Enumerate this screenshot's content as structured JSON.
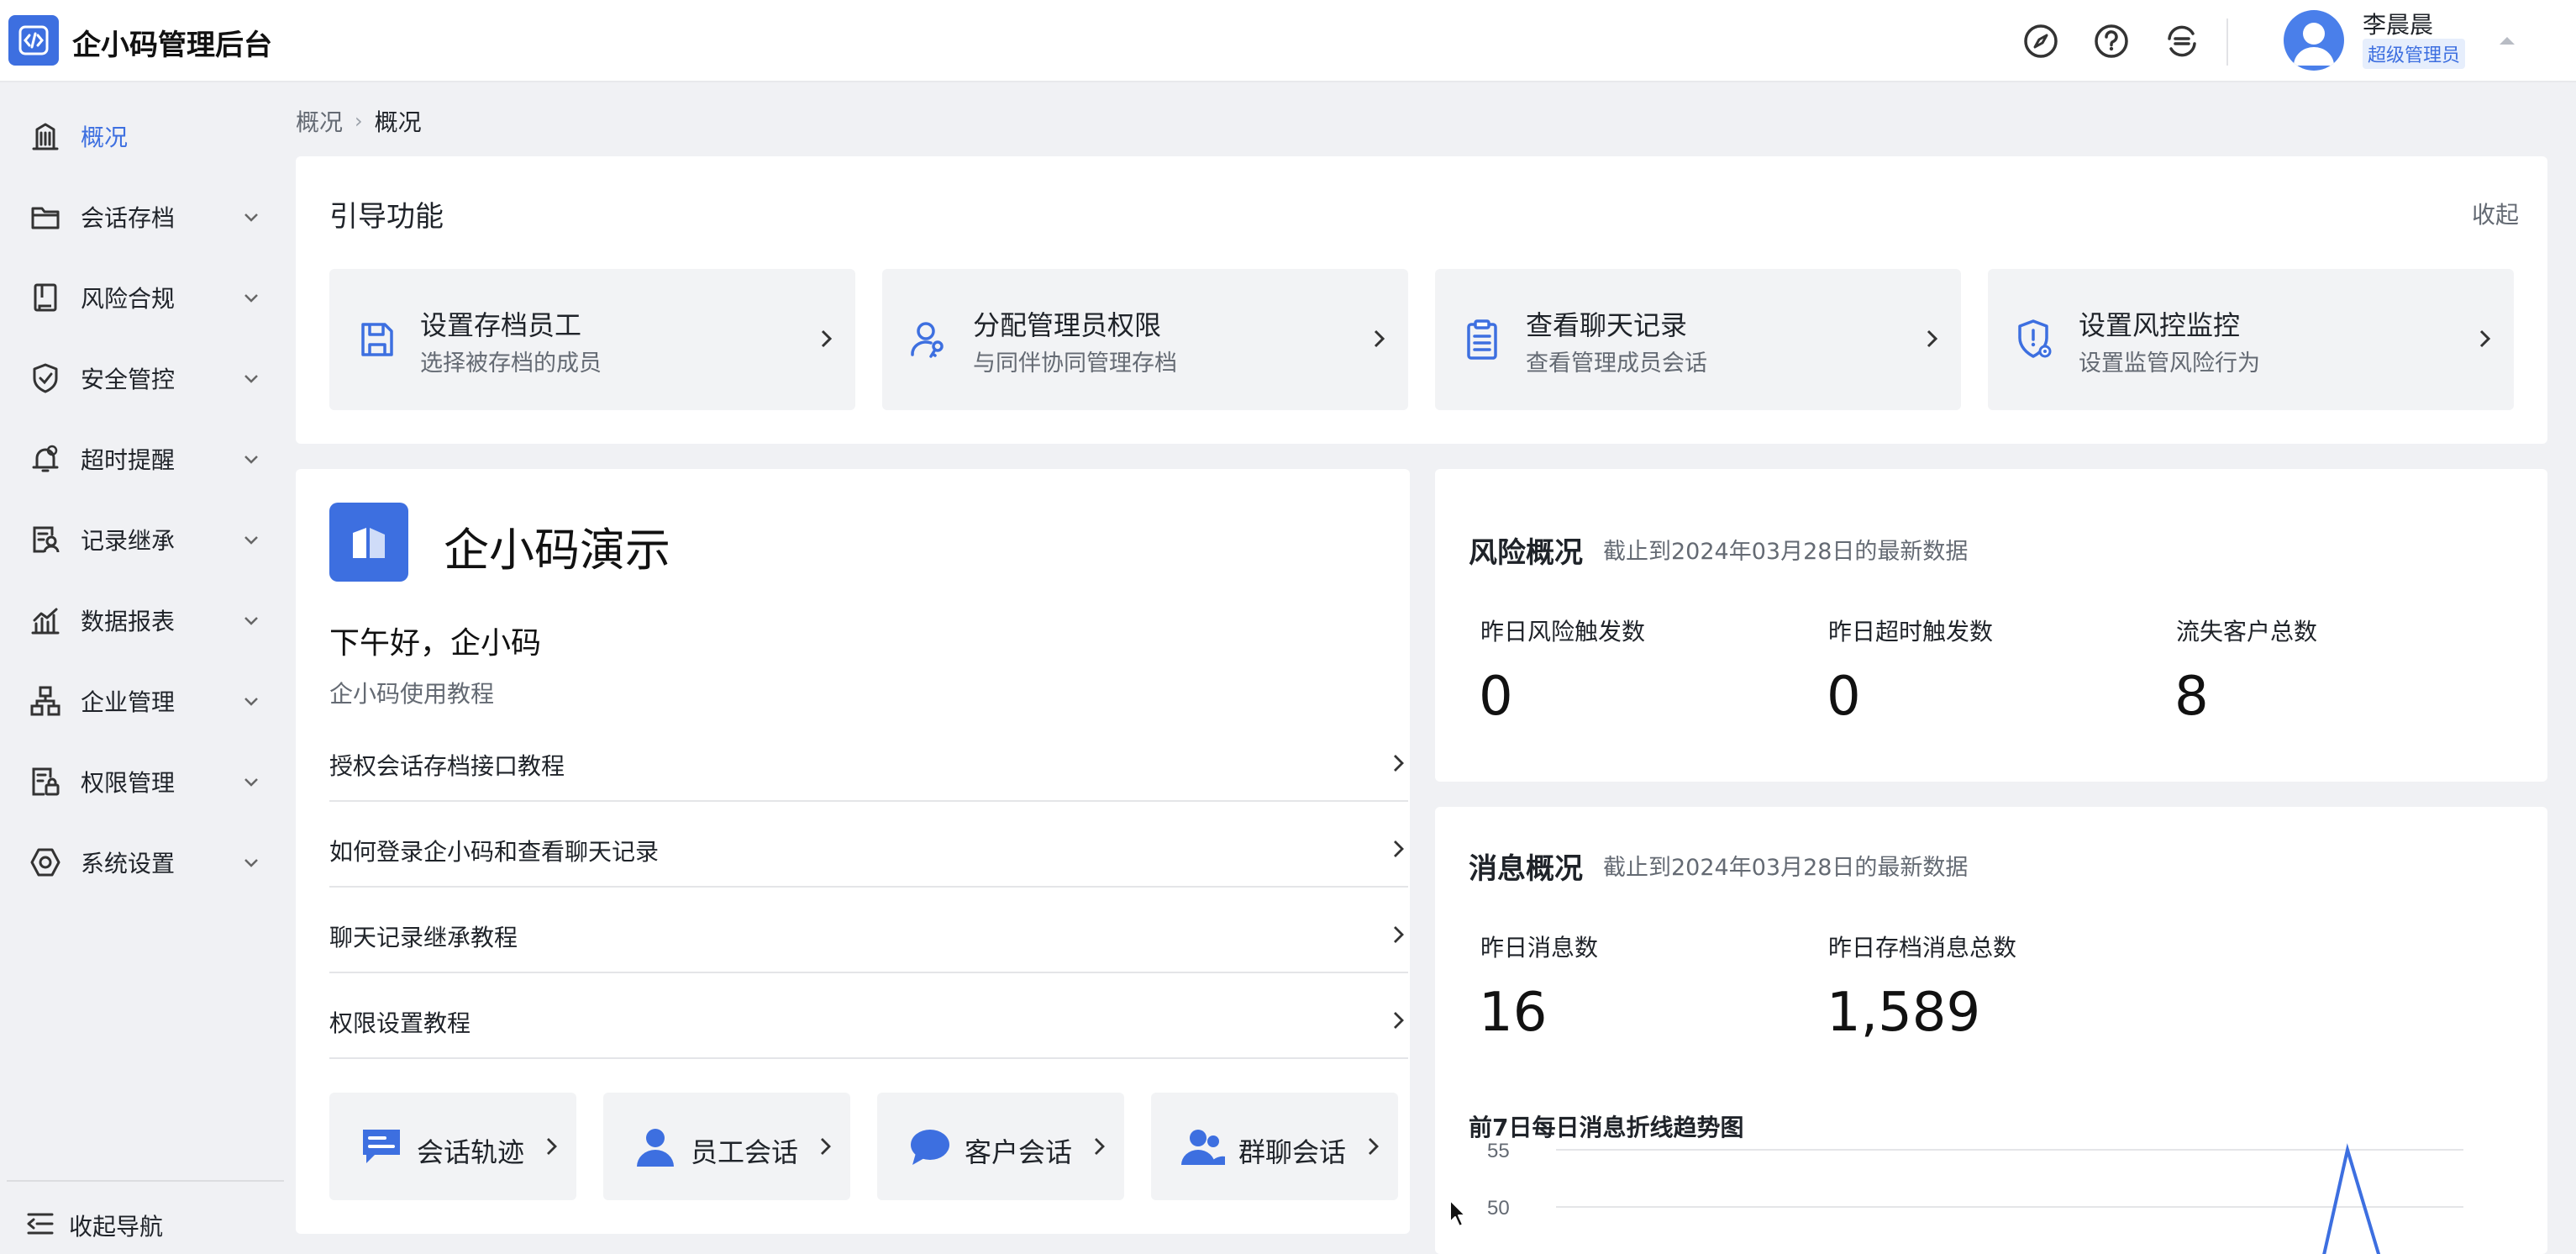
{
  "app": {
    "title": "企小码管理后台"
  },
  "user": {
    "name": "李晨晨",
    "role": "超级管理员"
  },
  "sidebar": {
    "items": [
      {
        "label": "概况",
        "icon": "building-icon",
        "active": true
      },
      {
        "label": "会话存档",
        "icon": "folder-icon"
      },
      {
        "label": "风险合规",
        "icon": "book-icon"
      },
      {
        "label": "安全管控",
        "icon": "shield-check-icon"
      },
      {
        "label": "超时提醒",
        "icon": "bell-icon"
      },
      {
        "label": "记录继承",
        "icon": "user-record-icon"
      },
      {
        "label": "数据报表",
        "icon": "chart-icon"
      },
      {
        "label": "企业管理",
        "icon": "org-icon"
      },
      {
        "label": "权限管理",
        "icon": "permission-icon"
      },
      {
        "label": "系统设置",
        "icon": "settings-hex-icon"
      }
    ],
    "collapse_label": "收起导航"
  },
  "breadcrumb": {
    "parent": "概况",
    "current": "概况"
  },
  "guide": {
    "title": "引导功能",
    "collapse_label": "收起",
    "tiles": [
      {
        "title": "设置存档员工",
        "subtitle": "选择被存档的成员",
        "icon": "save-icon"
      },
      {
        "title": "分配管理员权限",
        "subtitle": "与同伴协同管理存档",
        "icon": "user-key-icon"
      },
      {
        "title": "查看聊天记录",
        "subtitle": "查看管理成员会话",
        "icon": "clipboard-icon"
      },
      {
        "title": "设置风控监控",
        "subtitle": "设置监管风险行为",
        "icon": "shield-alert-icon"
      }
    ]
  },
  "demo": {
    "name": "企小码演示",
    "greeting": "下午好，企小码",
    "tutorial_heading": "企小码使用教程",
    "tutorials": [
      "授权会话存档接口教程",
      "如何登录企小码和查看聊天记录",
      "聊天记录继承教程",
      "权限设置教程"
    ],
    "quick_links": [
      {
        "label": "会话轨迹",
        "icon": "chat-track-icon"
      },
      {
        "label": "员工会话",
        "icon": "person-icon"
      },
      {
        "label": "客户会话",
        "icon": "speech-bubble-icon"
      },
      {
        "label": "群聊会话",
        "icon": "group-icon"
      }
    ]
  },
  "risk": {
    "title": "风险概况",
    "subtitle": "截止到2024年03月28日的最新数据",
    "metrics": [
      {
        "label": "昨日风险触发数",
        "value": "0"
      },
      {
        "label": "昨日超时触发数",
        "value": "0"
      },
      {
        "label": "流失客户总数",
        "value": "8"
      }
    ]
  },
  "messages": {
    "title": "消息概况",
    "subtitle": "截止到2024年03月28日的最新数据",
    "metrics": [
      {
        "label": "昨日消息数",
        "value": "16"
      },
      {
        "label": "昨日存档消息总数",
        "value": "1,589"
      }
    ],
    "chart_title": "前7日每日消息折线趋势图"
  },
  "colors": {
    "accent": "#3d6fe0",
    "background": "#f0f1f4",
    "card": "#ffffff",
    "tile": "#f2f3f5"
  },
  "chart_data": {
    "type": "line",
    "title": "前7日每日消息折线趋势图",
    "y_ticks": [
      "55",
      "50"
    ],
    "ylim": [
      50,
      55
    ],
    "grid": true,
    "visible_peak_value": 55,
    "note_visible": "chart partially cropped at bottom; only the top ticks and a single peak are visible"
  }
}
